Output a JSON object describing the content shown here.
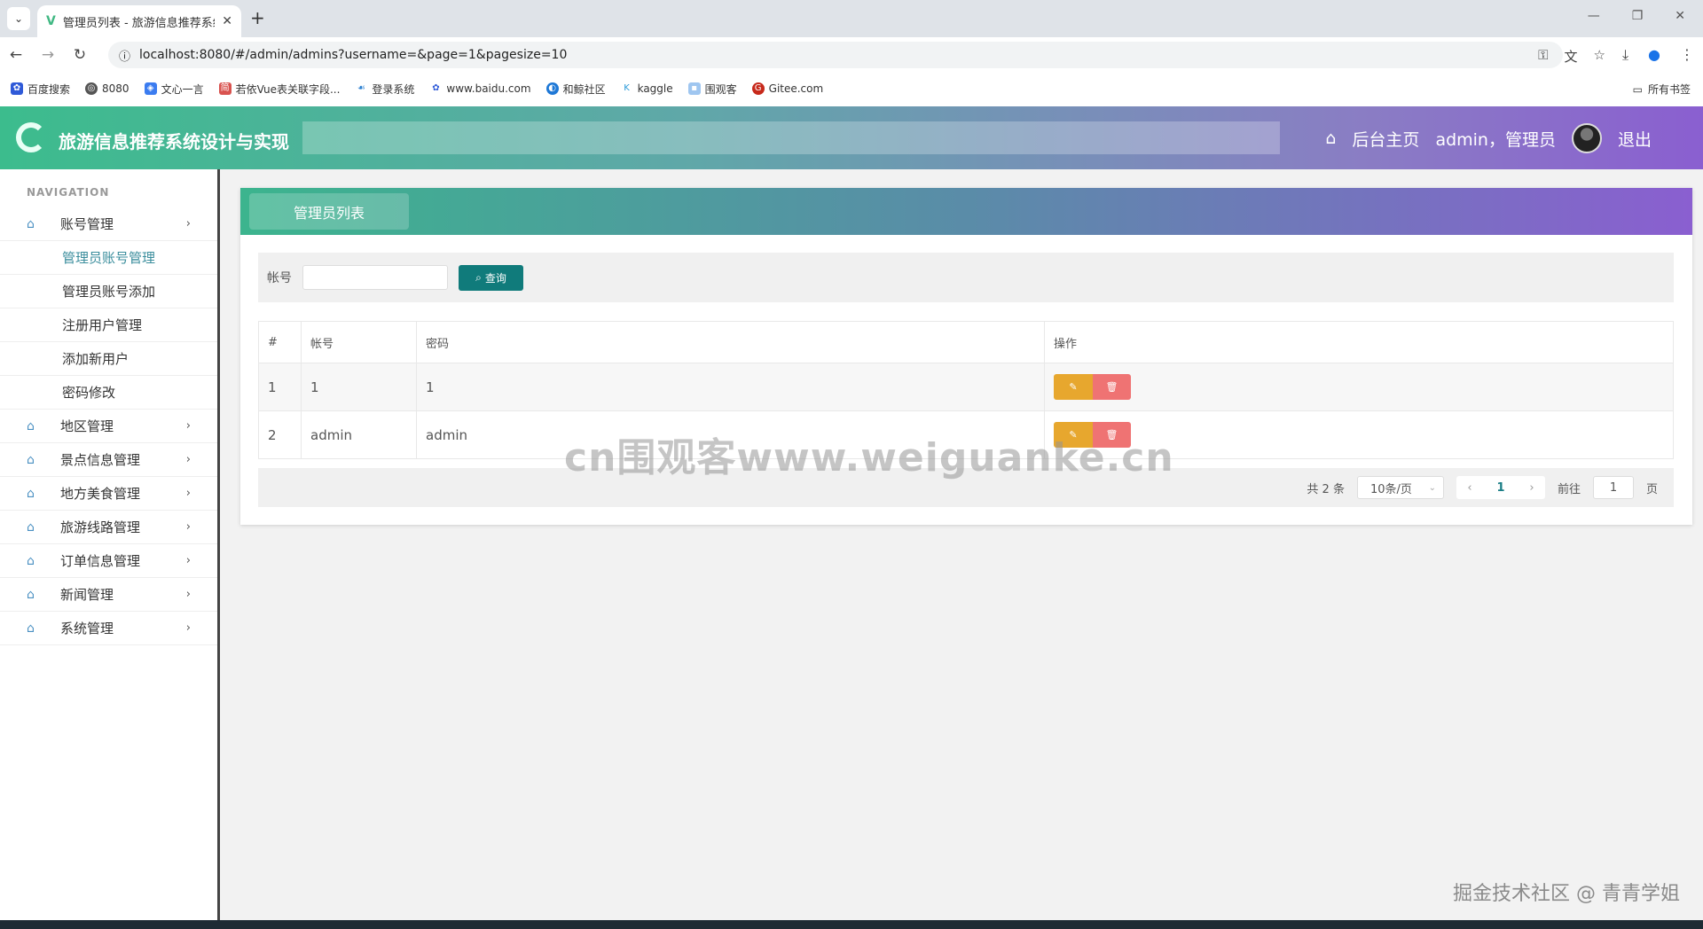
{
  "browser": {
    "tab_title": "管理员列表 - 旅游信息推荐系统",
    "url": "localhost:8080/#/admin/admins?username=&page=1&pagesize=10",
    "bookmarks": [
      "百度搜索",
      "8080",
      "文心一言",
      "若依Vue表关联字段...",
      "登录系统",
      "www.baidu.com",
      "和鲸社区",
      "kaggle",
      "围观客",
      "Gitee.com"
    ],
    "all_bookmarks": "所有书签"
  },
  "header": {
    "title": "旅游信息推荐系统设计与实现",
    "home_label": "后台主页",
    "user_label": "admin，管理员",
    "logout_label": "退出"
  },
  "sidebar": {
    "nav_label": "NAVIGATION",
    "account_menu": "账号管理",
    "sub_items": [
      "管理员账号管理",
      "管理员账号添加",
      "注册用户管理",
      "添加新用户",
      "密码修改"
    ],
    "menus": [
      "地区管理",
      "景点信息管理",
      "地方美食管理",
      "旅游线路管理",
      "订单信息管理",
      "新闻管理",
      "系统管理"
    ]
  },
  "main": {
    "panel_title": "管理员列表",
    "search_label": "帐号",
    "search_placeholder": "",
    "search_button": "查询",
    "columns": [
      "#",
      "帐号",
      "密码",
      "操作"
    ],
    "rows": [
      {
        "index": "1",
        "account": "1",
        "password": "1"
      },
      {
        "index": "2",
        "account": "admin",
        "password": "admin"
      }
    ],
    "pager": {
      "total": "共 2 条",
      "page_size": "10条/页",
      "current_page": "1",
      "goto_label": "前往",
      "goto_value": "1",
      "page_suffix": "页"
    }
  },
  "watermark": "cn围观客www.weiguanke.cn",
  "corner_watermark": "掘金技术社区 @ 青青学姐",
  "colors": {
    "accent": "#107b7b",
    "edit": "#e7a72e",
    "delete": "#ef7373"
  }
}
